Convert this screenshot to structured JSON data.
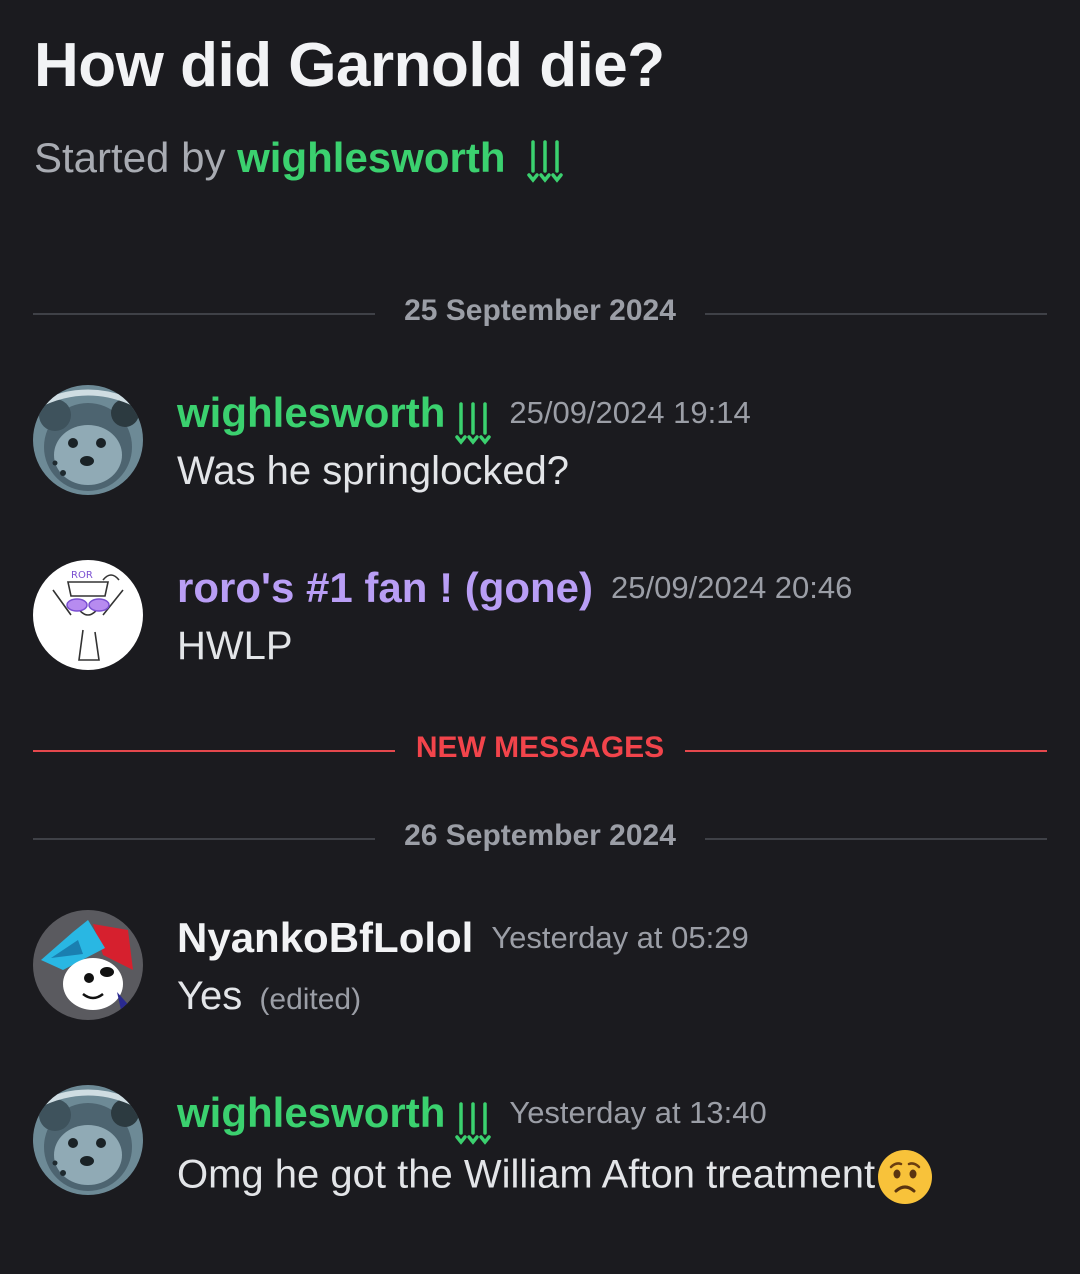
{
  "thread": {
    "title": "How did Garnold die?",
    "started_by_prefix": "Started by",
    "starter": "wighlesworth"
  },
  "dividers": {
    "date_1": "25 September 2024",
    "new_messages": "NEW MESSAGES",
    "date_2": "26 September 2024"
  },
  "messages": [
    {
      "author": "wighlesworth",
      "timestamp": "25/09/2024 19:14",
      "text": "Was he springlocked?",
      "author_color": "#3bd16f",
      "tag_icon": "pitchfork-tag-icon"
    },
    {
      "author": "roro's #1 fan ! (gone)",
      "timestamp": "25/09/2024 20:46",
      "text": "HWLP",
      "author_color": "#b99ef5"
    },
    {
      "author": "NyankoBfLolol",
      "timestamp": "Yesterday at 05:29",
      "text": "Yes",
      "edited": "(edited)",
      "author_color": "#f2f3f5"
    },
    {
      "author": "wighlesworth",
      "timestamp": "Yesterday at 13:40",
      "text": "Omg he got the William Afton treatment",
      "emoji": "worried-face-emoji",
      "author_color": "#3bd16f",
      "tag_icon": "pitchfork-tag-icon"
    }
  ],
  "colors": {
    "background": "#1b1b1f",
    "new_messages": "#f2444b",
    "green_role": "#3bd16f",
    "purple_role": "#b99ef5"
  }
}
